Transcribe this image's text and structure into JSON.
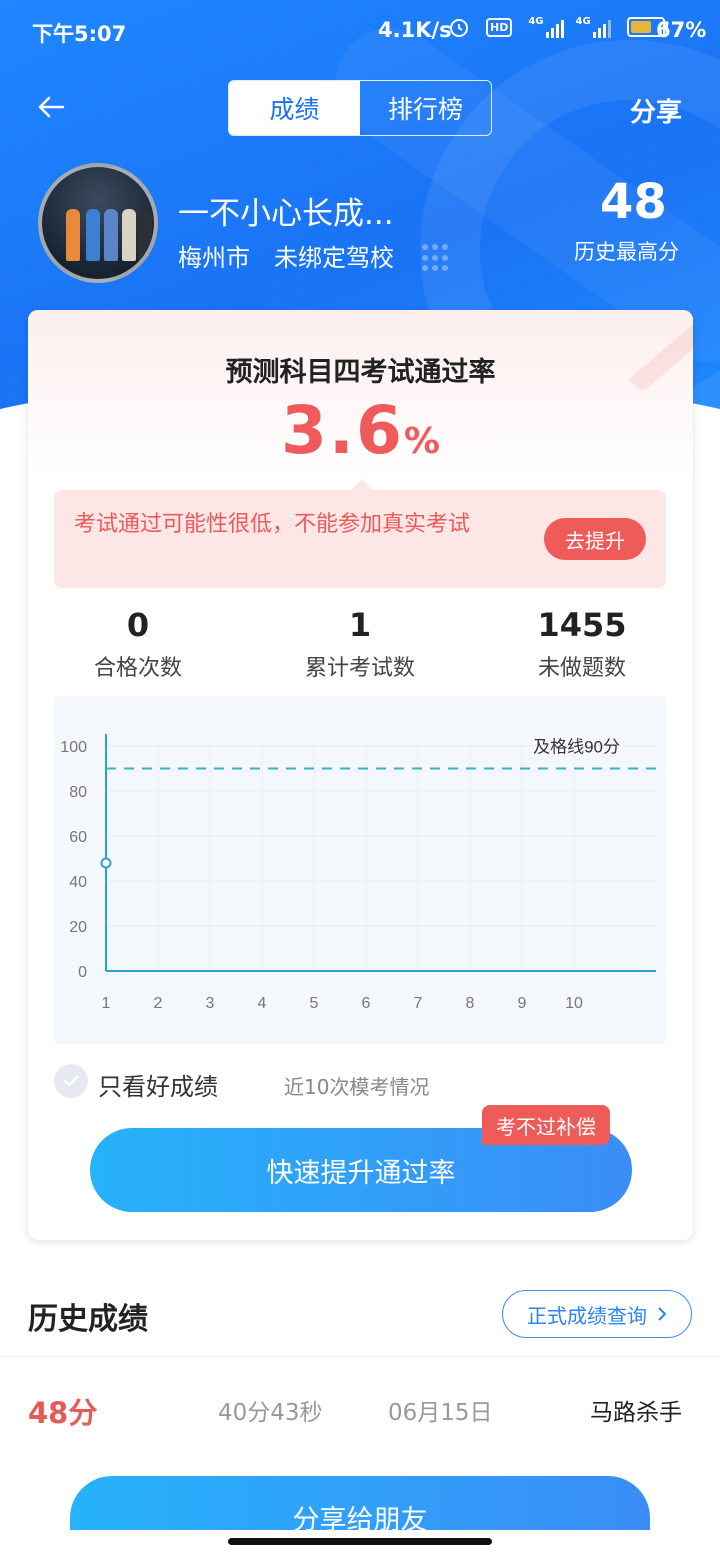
{
  "status_bar": {
    "time": "下午5:07",
    "network_speed": "4.1K/s",
    "hd_label": "HD",
    "net_type_1": "4G",
    "net_type_2": "4G",
    "battery_percent": "67%"
  },
  "nav": {
    "tabs": [
      {
        "label": "成绩",
        "active": true
      },
      {
        "label": "排行榜",
        "active": false
      }
    ],
    "share_label": "分享"
  },
  "profile": {
    "name": "一不小心长成...",
    "city": "梅州市",
    "school": "未绑定驾校",
    "best_score": "48",
    "best_score_label": "历史最高分"
  },
  "prediction": {
    "title": "预测科目四考试通过率",
    "rate_value": "3.6",
    "rate_unit": "%",
    "tip_text": "考试通过可能性很低，不能参加真实考试",
    "tip_button": "去提升"
  },
  "stats": [
    {
      "value": "0",
      "label": "合格次数"
    },
    {
      "value": "1",
      "label": "累计考试数"
    },
    {
      "value": "1455",
      "label": "未做题数"
    }
  ],
  "chart_data": {
    "type": "line",
    "x": [
      1,
      2,
      3,
      4,
      5,
      6,
      7,
      8,
      9,
      10
    ],
    "xlim": [
      1,
      10
    ],
    "ylim": [
      0,
      100
    ],
    "y_ticks": [
      0,
      20,
      40,
      60,
      80,
      100
    ],
    "series": [
      {
        "values": [
          48
        ]
      }
    ],
    "reference_line": {
      "value": 90,
      "label": "及格线90分"
    },
    "grid": true
  },
  "filter": {
    "good_only_label": "只看好成绩",
    "recent_label": "近10次模考情况"
  },
  "boost": {
    "button_label": "快速提升通过率",
    "badge": "考不过补偿"
  },
  "history": {
    "title": "历史成绩",
    "query_button": "正式成绩查询",
    "rows": [
      {
        "score": "48分",
        "duration": "40分43秒",
        "date": "06月15日",
        "tag": "马路杀手"
      }
    ]
  },
  "share_friends": "分享给朋友",
  "colors": {
    "primary_blue": "#1a73f5",
    "accent_red": "#ef5b58",
    "chart_line": "#2aa0df"
  }
}
